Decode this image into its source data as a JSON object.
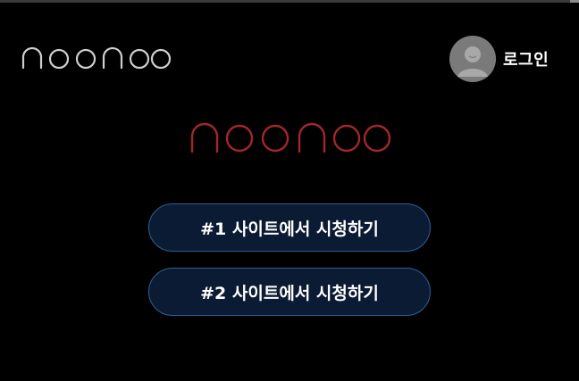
{
  "app": {
    "brand_name": "noonoo"
  },
  "header": {
    "login_label": "로그인",
    "avatar_icon": "user-avatar-icon"
  },
  "main": {
    "buttons": [
      {
        "label": "#1 사이트에서 시청하기"
      },
      {
        "label": "#2 사이트에서 시청하기"
      }
    ]
  },
  "colors": {
    "background": "#000000",
    "header_logo": "#cfcfcf",
    "hero_logo": "#a3262a",
    "button_fill": "#0b1b33",
    "button_border": "#2f5f9a",
    "avatar_bg": "#7a7a7a"
  }
}
